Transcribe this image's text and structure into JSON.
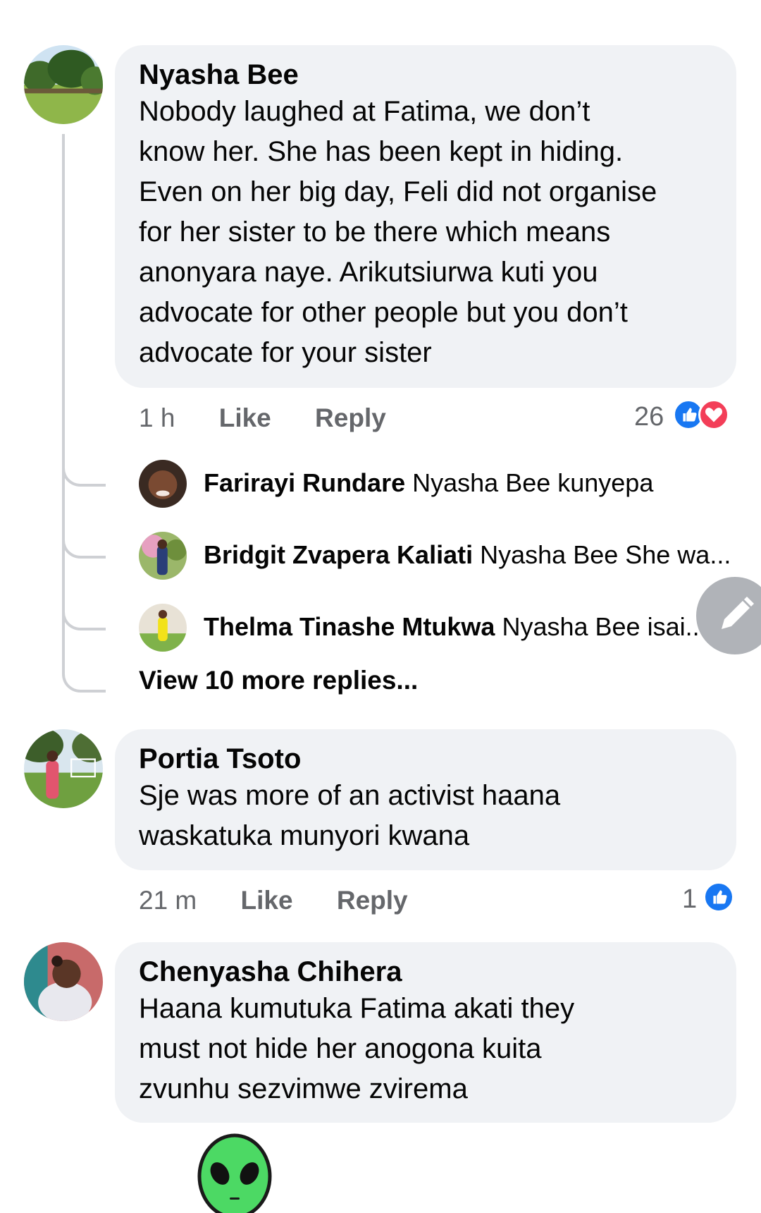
{
  "comments": [
    {
      "author": "Nyasha Bee",
      "text": "Nobody laughed at Fatima, we don’t\nknow her. She has been kept in hiding.\nEven on her big day, Feli did not organise\nfor her sister to be there which means\nanonyara naye. Arikutsiurwa kuti you\nadvocate for other people but you don’t\nadvocate for your sister",
      "time": "1 h",
      "like_label": "Like",
      "reply_label": "Reply",
      "reaction_count": "26",
      "reactions": [
        "like-icon",
        "love-icon"
      ]
    },
    {
      "author": "Portia Tsoto",
      "text": "Sje was more of an activist haana\nwaskatuka munyori kwana",
      "time": "21 m",
      "like_label": "Like",
      "reply_label": "Reply",
      "reaction_count": "1",
      "reactions": [
        "like-icon"
      ]
    },
    {
      "author": "Chenyasha Chihera",
      "text": "Haana  kumutuka  Fatima akati  they\nmust not hide  her  anogona  kuita\nzvunhu  sezvimwe  zvirema"
    }
  ],
  "replies": [
    {
      "author": "Farirayi Rundare",
      "text": "Nyasha Bee kunyepa"
    },
    {
      "author": "Bridgit Zvapera Kaliati",
      "text": "Nyasha Bee She wa..."
    },
    {
      "author": "Thelma Tinashe Mtukwa",
      "text": "Nyasha Bee isai..."
    }
  ],
  "view_more": "View 10 more replies...",
  "colors": {
    "bubble": "#f0f2f5",
    "meta_text": "#65676b",
    "like_blue": "#1877f2",
    "love_red": "#f33e58",
    "thread_line": "#ced0d4"
  },
  "icons": [
    "pencil-icon",
    "alien-emoji-icon"
  ]
}
